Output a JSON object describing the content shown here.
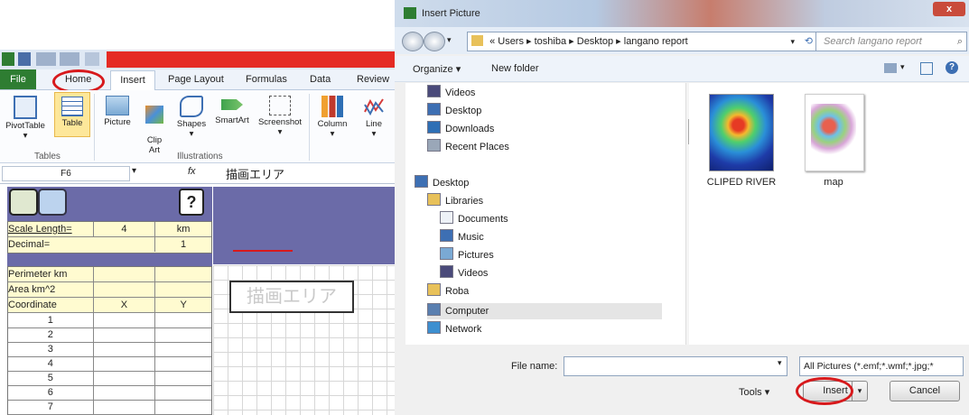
{
  "excel": {
    "tabs": [
      "File",
      "Home",
      "Insert",
      "Page Layout",
      "Formulas",
      "Data",
      "Review"
    ],
    "ribbon_buttons": [
      "PivotTable",
      "Table",
      "Picture",
      "Clip\nArt",
      "Shapes",
      "SmartArt",
      "Screenshot",
      "Column",
      "Line"
    ],
    "groups": [
      "Tables",
      "Illustrations"
    ],
    "name_box": "F6",
    "formula_fx": "fx",
    "formula_value": "描画エリア",
    "help_symbol": "?",
    "scale_label": "Scale Length=",
    "scale_value": "4",
    "scale_unit": "km",
    "decimal_label": "Decimal=",
    "decimal_value": "1",
    "perimeter_label": "Perimeter km",
    "area_label": "Area km^2",
    "coord_header": [
      "Coordinate",
      "X",
      "Y"
    ],
    "rows": [
      "1",
      "2",
      "3",
      "4",
      "5",
      "6",
      "7"
    ],
    "draw_area_text": "描画エリア",
    "home_highlight_color": "#d7191c"
  },
  "dialog": {
    "title": "Insert Picture",
    "close_symbol": "x",
    "breadcrumb": [
      "«",
      "Users",
      "toshiba",
      "Desktop",
      "langano report"
    ],
    "search_placeholder": "Search langano report",
    "organize_label": "Organize ▾",
    "new_folder_label": "New folder",
    "nav_items": [
      {
        "label": "Videos",
        "icon": "video-icon"
      },
      {
        "label": "Desktop",
        "icon": "desktop-icon"
      },
      {
        "label": "Downloads",
        "icon": "download-icon"
      },
      {
        "label": "Recent Places",
        "icon": "recent-icon"
      },
      {
        "label": "Desktop",
        "icon": "desktop-icon"
      },
      {
        "label": "Libraries",
        "icon": "library-icon"
      },
      {
        "label": "Documents",
        "icon": "document-icon"
      },
      {
        "label": "Music",
        "icon": "music-icon"
      },
      {
        "label": "Pictures",
        "icon": "picture-icon"
      },
      {
        "label": "Videos",
        "icon": "video-icon"
      },
      {
        "label": "Roba",
        "icon": "user-icon"
      },
      {
        "label": "Computer",
        "icon": "computer-icon"
      },
      {
        "label": "Network",
        "icon": "network-icon"
      }
    ],
    "files": [
      {
        "name": "CLIPED RIVER",
        "icon": "river-thumbnail"
      },
      {
        "name": "map",
        "icon": "map-thumbnail"
      }
    ],
    "file_name_label": "File name:",
    "file_name_value": "",
    "filter_value": "All Pictures (*.emf;*.wmf;*.jpg;*",
    "tools_label": "Tools ▾",
    "insert_label": "Insert",
    "cancel_label": "Cancel",
    "insert_highlight_color": "#d7191c"
  }
}
